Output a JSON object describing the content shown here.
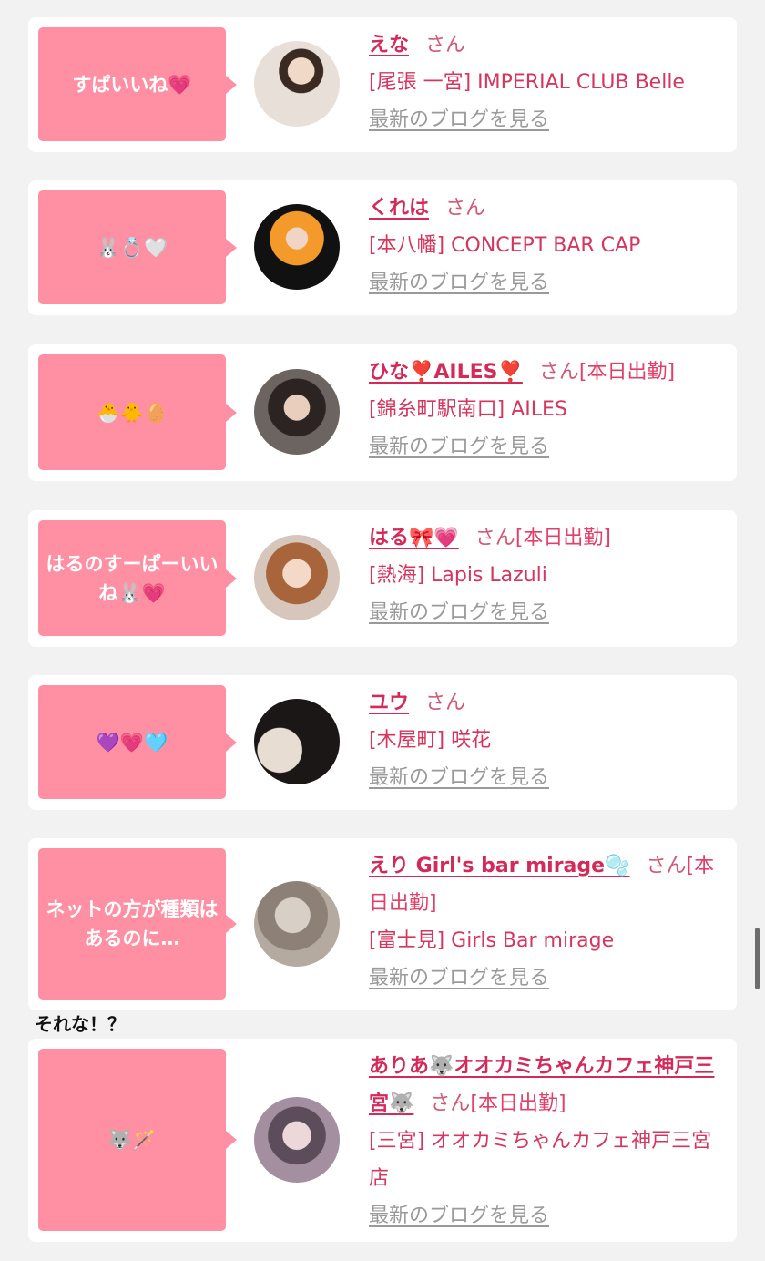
{
  "cards": [
    {
      "bubble": "すぱいいね💗",
      "name": "えな",
      "san": "さん",
      "san_suffix": "",
      "shop": "[尾張 一宮] IMPERIAL CLUB Belle",
      "blog": "最新のブログを見る"
    },
    {
      "bubble": "🐰💍🤍",
      "name": "くれは",
      "san": "さん",
      "san_suffix": "",
      "shop": "[本八幡] CONCEPT BAR CAP",
      "blog": "最新のブログを見る"
    },
    {
      "bubble": "🐣🐥🥚",
      "name": "ひな❣️AILES❣️",
      "san": "さん",
      "san_suffix": "[本日出勤]",
      "shop": "[錦糸町駅南口] AILES",
      "blog": "最新のブログを見る"
    },
    {
      "bubble": "はるのすーぱーいいね🐰💗",
      "name": "はる🎀💗",
      "san": "さん",
      "san_suffix": "[本日出勤]",
      "shop": "[熱海] Lapis Lazuli",
      "blog": "最新のブログを見る"
    },
    {
      "bubble": "💜💗🩵",
      "name": "ユウ",
      "san": "さん",
      "san_suffix": "",
      "shop": "[木屋町] 咲花",
      "blog": "最新のブログを見る"
    },
    {
      "bubble": "ネットの方が種類はあるのに…",
      "name": "えり Girl's bar mirage🫧",
      "san": "さん",
      "san_suffix": "[本日出勤]",
      "shop": "[富士見] Girls Bar mirage",
      "blog": "最新のブログを見る"
    },
    {
      "bubble": "🐺🪄",
      "name": "ありあ🐺オオカミちゃんカフェ神戸三宮🐺",
      "san": "さん",
      "san_suffix": "[本日出勤]",
      "shop": "[三宮] オオカミちゃんカフェ神戸三宮店",
      "blog": "最新のブログを見る"
    }
  ],
  "remark": "それな！？",
  "colors": {
    "bubble": "#ff8fa3",
    "name": "#d42a5a",
    "text": "#e0406a",
    "link": "#9a9a9a"
  }
}
